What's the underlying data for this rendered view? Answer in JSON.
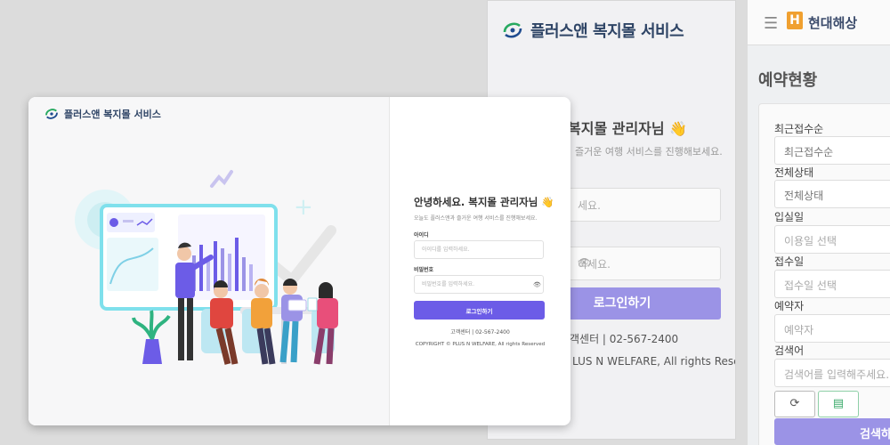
{
  "bg_login": {
    "brand": "플러스앤 복지몰 서비스",
    "greeting": "복지몰 관리자님 👋",
    "greeting_sub": "즐거운 여행 서비스를 진행해보세요.",
    "id_placeholder_partial": "세요.",
    "pw_placeholder_partial": "하세요.",
    "login_button": "로그인하기",
    "customer_center": "객센터  |  02-567-2400",
    "copyright": "LUS N WELFARE, All rights Reserved"
  },
  "bg_reservation": {
    "company": "현대해상",
    "page_title": "예약현황",
    "fields": {
      "recent_label": "최근접수순",
      "recent_value": "최근접수순",
      "status_label": "전체상태",
      "status_value": "전체상태",
      "checkin_label": "입실일",
      "checkin_placeholder": "이용일 선택",
      "receipt_label": "접수일",
      "receipt_placeholder": "접수일 선택",
      "booker_label": "예약자",
      "booker_value": "예약자",
      "keyword_label": "검색어",
      "keyword_placeholder": "검색어를 입력해주세요."
    },
    "search_button": "검색하"
  },
  "login": {
    "brand": "플러스앤 복지몰 서비스",
    "title": "안녕하세요. 복지몰 관리자님 👋",
    "subtitle": "오늘도 플러스앤과 즐거운 여행 서비스를 진행해보세요.",
    "id_label": "아이디",
    "id_placeholder": "아이디를 입력하세요.",
    "pw_label": "비밀번호",
    "pw_placeholder": "비밀번호를 입력하세요.",
    "login_button": "로그인하기",
    "customer_center": "고객센터  |  02-567-2400",
    "copyright": "COPYRIGHT © PLUS N WELFARE, All rights Reserved"
  },
  "colors": {
    "accent": "#6c5ce7",
    "accent_soft": "#9b93e6",
    "brand_text": "#2f4566"
  }
}
